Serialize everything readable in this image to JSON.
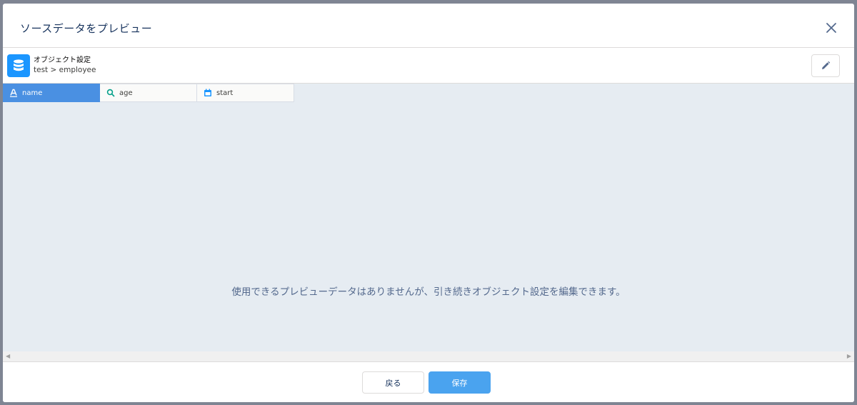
{
  "modal": {
    "title": "ソースデータをプレビュー",
    "close_icon": "close-icon"
  },
  "object": {
    "icon": "database-icon",
    "icon_color": "#1b96ff",
    "label": "オブジェクト設定",
    "path": "test > employee",
    "edit_icon": "pencil-icon"
  },
  "columns": [
    {
      "label": "name",
      "type_icon": "text-type-icon",
      "active": true
    },
    {
      "label": "age",
      "type_icon": "numeric-type-icon",
      "active": false
    },
    {
      "label": "start",
      "type_icon": "date-type-icon",
      "active": false
    }
  ],
  "preview": {
    "empty_message": "使用できるプレビューデータはありませんが、引き続きオブジェクト設定を編集できます。"
  },
  "footer": {
    "back_label": "戻る",
    "save_label": "保存"
  },
  "colors": {
    "accent": "#4a90e2",
    "save_button": "#4aa3ef",
    "preview_background": "#e6ecf2"
  }
}
